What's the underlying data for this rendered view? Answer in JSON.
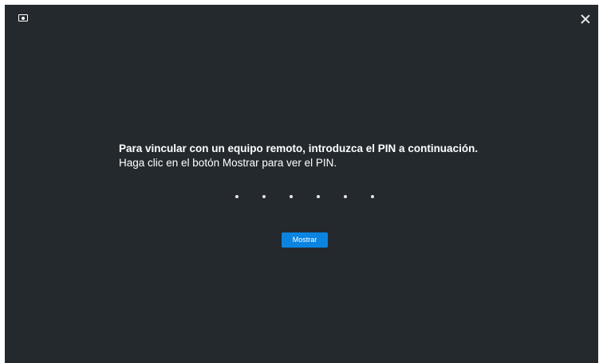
{
  "window": {
    "app_icon": "screen-icon",
    "close_icon": "close-icon"
  },
  "prompt": {
    "headline": "Para vincular con un equipo remoto, introduzca el PIN a continuación.",
    "instruction": "Haga clic en el botón Mostrar para ver el PIN."
  },
  "pin": {
    "digit_count": 6,
    "masked": true
  },
  "actions": {
    "show_label": "Mostrar"
  },
  "colors": {
    "background": "#24292e",
    "accent": "#0a84e0",
    "text": "#ffffff"
  }
}
